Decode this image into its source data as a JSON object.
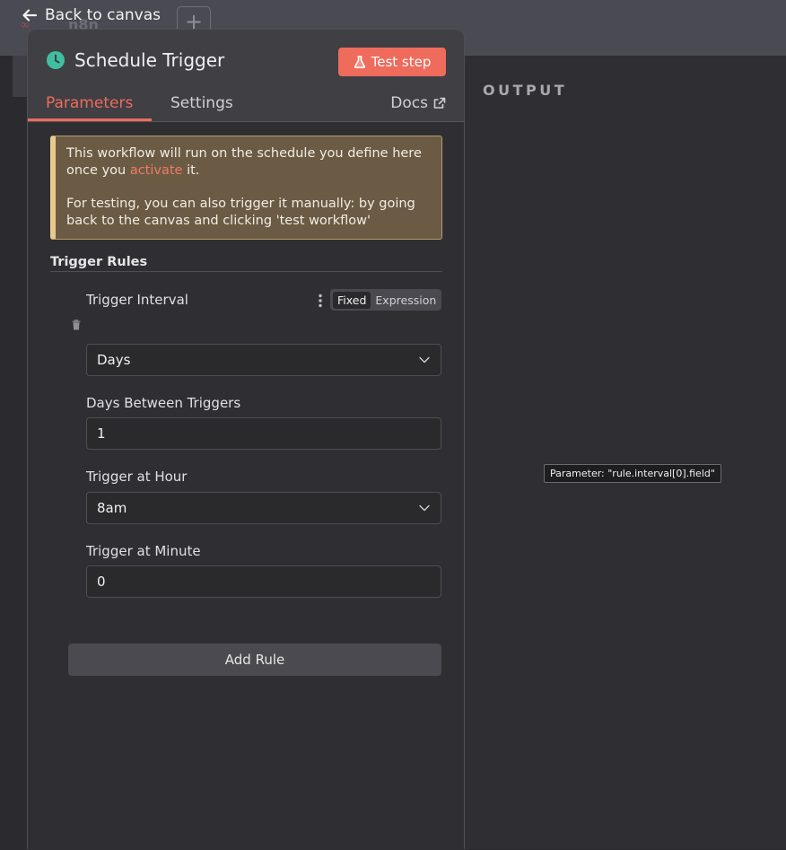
{
  "background": {
    "workflow_name": "n8n",
    "output_label": "OUTPUT"
  },
  "nav": {
    "back_label": "Back to canvas"
  },
  "node": {
    "title": "Schedule Trigger",
    "test_button_label": "Test step"
  },
  "tabs": {
    "parameters": "Parameters",
    "settings": "Settings",
    "docs": "Docs"
  },
  "notice": {
    "line1_before": "This workflow will run on the schedule you define here once you ",
    "line1_link": "activate",
    "line1_after": " it.",
    "line2": "For testing, you can also trigger it manually: by going back to the canvas and clicking 'test workflow'"
  },
  "rules": {
    "section_title": "Trigger Rules",
    "interval_label": "Trigger Interval",
    "mode_fixed": "Fixed",
    "mode_expression": "Expression",
    "interval_value": "Days",
    "days_label": "Days Between Triggers",
    "days_value": "1",
    "hour_label": "Trigger at Hour",
    "hour_value": "8am",
    "minute_label": "Trigger at Minute",
    "minute_value": "0",
    "add_rule_label": "Add Rule"
  },
  "tooltip": {
    "text": "Parameter: \"rule.interval[0].field\""
  },
  "colors": {
    "accent": "#ef6b5b",
    "clock_icon": "#3fbf9f",
    "notice_border": "#e9c98c"
  }
}
